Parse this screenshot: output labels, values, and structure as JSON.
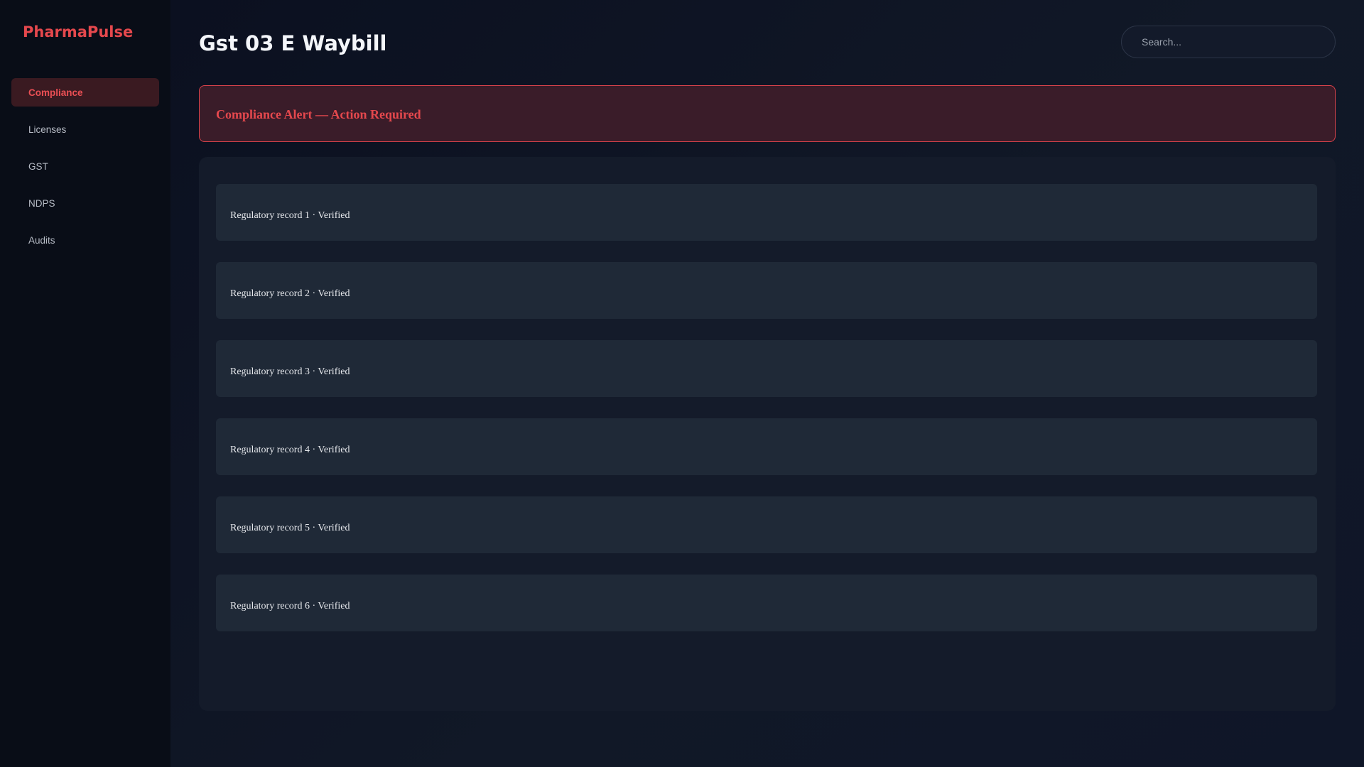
{
  "sidebar": {
    "brand": "PharmaPulse",
    "items": [
      {
        "label": "Compliance",
        "active": true
      },
      {
        "label": "Licenses",
        "active": false
      },
      {
        "label": "GST",
        "active": false
      },
      {
        "label": "NDPS",
        "active": false
      },
      {
        "label": "Audits",
        "active": false
      }
    ]
  },
  "header": {
    "title": "Gst 03 E Waybill",
    "search_placeholder": "Search..."
  },
  "alert": {
    "text": "Compliance Alert — Action Required"
  },
  "records": [
    {
      "text": "Regulatory record 1 · Verified"
    },
    {
      "text": "Regulatory record 2 · Verified"
    },
    {
      "text": "Regulatory record 3 · Verified"
    },
    {
      "text": "Regulatory record 4 · Verified"
    },
    {
      "text": "Regulatory record 5 · Verified"
    },
    {
      "text": "Regulatory record 6 · Verified"
    }
  ],
  "colors": {
    "accent": "#e5484d",
    "background": "#0d1220",
    "sidebar": "#090d17",
    "card": "#1f2937"
  }
}
